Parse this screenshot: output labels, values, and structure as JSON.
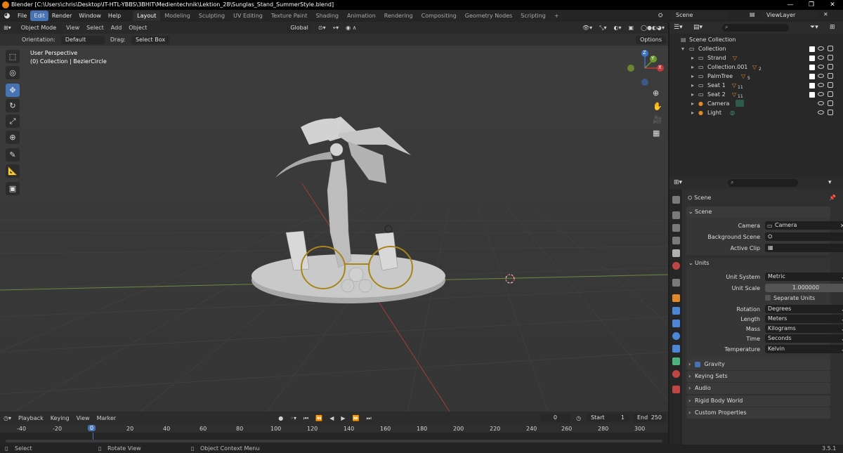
{
  "window": {
    "title": "Blender [C:\\Users\\chris\\Desktop\\IT-HTL-YBBS\\3BHIT\\Medientechnik\\Lektion_28\\Sunglas_Stand_SummerStyle.blend]",
    "controls": [
      "—",
      "❐",
      "✕"
    ]
  },
  "menu": [
    "File",
    "Edit",
    "Render",
    "Window",
    "Help"
  ],
  "workspaces": [
    "Layout",
    "Modeling",
    "Sculpting",
    "UV Editing",
    "Texture Paint",
    "Shading",
    "Animation",
    "Rendering",
    "Compositing",
    "Geometry Nodes",
    "Scripting"
  ],
  "top_right": {
    "scene": "Scene",
    "view_layer": "ViewLayer"
  },
  "viewport": {
    "mode": "Object Mode",
    "menus": [
      "View",
      "Select",
      "Add",
      "Object"
    ],
    "transform": "Global",
    "orientation_label": "Orientation:",
    "orientation_value": "Default",
    "drag_label": "Drag:",
    "drag_value": "Select Box",
    "options": "Options",
    "overlay_title": "User Perspective",
    "overlay_sub": "(0) Collection | BezierCircle",
    "gizmo": {
      "x": "X",
      "y": "Y",
      "z": "Z"
    }
  },
  "outliner": {
    "root": "Scene Collection",
    "collection": "Collection",
    "items": [
      {
        "name": "Strand",
        "badge": ""
      },
      {
        "name": "Collection.001",
        "badge": "2"
      },
      {
        "name": "PalmTree",
        "badge": "5"
      },
      {
        "name": "Seat 1",
        "badge": "11"
      },
      {
        "name": "Seat 2",
        "badge": "11"
      },
      {
        "name": "Camera",
        "badge": ""
      },
      {
        "name": "Light",
        "badge": ""
      }
    ]
  },
  "properties": {
    "context": "Scene",
    "panel_scene": "Scene",
    "camera_label": "Camera",
    "camera_value": "Camera",
    "bg_scene_label": "Background Scene",
    "active_clip_label": "Active Clip",
    "panel_units": "Units",
    "unit_system_label": "Unit System",
    "unit_system": "Metric",
    "unit_scale_label": "Unit Scale",
    "unit_scale": "1.000000",
    "separate_units": "Separate Units",
    "rotation_label": "Rotation",
    "rotation": "Degrees",
    "length_label": "Length",
    "length": "Meters",
    "mass_label": "Mass",
    "mass": "Kilograms",
    "time_label": "Time",
    "time": "Seconds",
    "temperature_label": "Temperature",
    "temperature": "Kelvin",
    "collapsed": [
      "Gravity",
      "Keying Sets",
      "Audio",
      "Rigid Body World",
      "Custom Properties"
    ]
  },
  "timeline": {
    "menus": [
      "Playback",
      "Keying",
      "View",
      "Marker"
    ],
    "current_frame": "0",
    "start_label": "Start",
    "start": "1",
    "end_label": "End",
    "end": "250",
    "ruler": [
      "-40",
      "-20",
      "0",
      "20",
      "40",
      "60",
      "80",
      "100",
      "120",
      "140",
      "160",
      "180",
      "200",
      "220",
      "240",
      "260",
      "280",
      "300"
    ]
  },
  "status": {
    "select": "Select",
    "rotate": "Rotate View",
    "context": "Object Context Menu",
    "version": "3.5.1"
  },
  "colors": {
    "accent": "#4772b3",
    "orange": "#e87d0d"
  }
}
